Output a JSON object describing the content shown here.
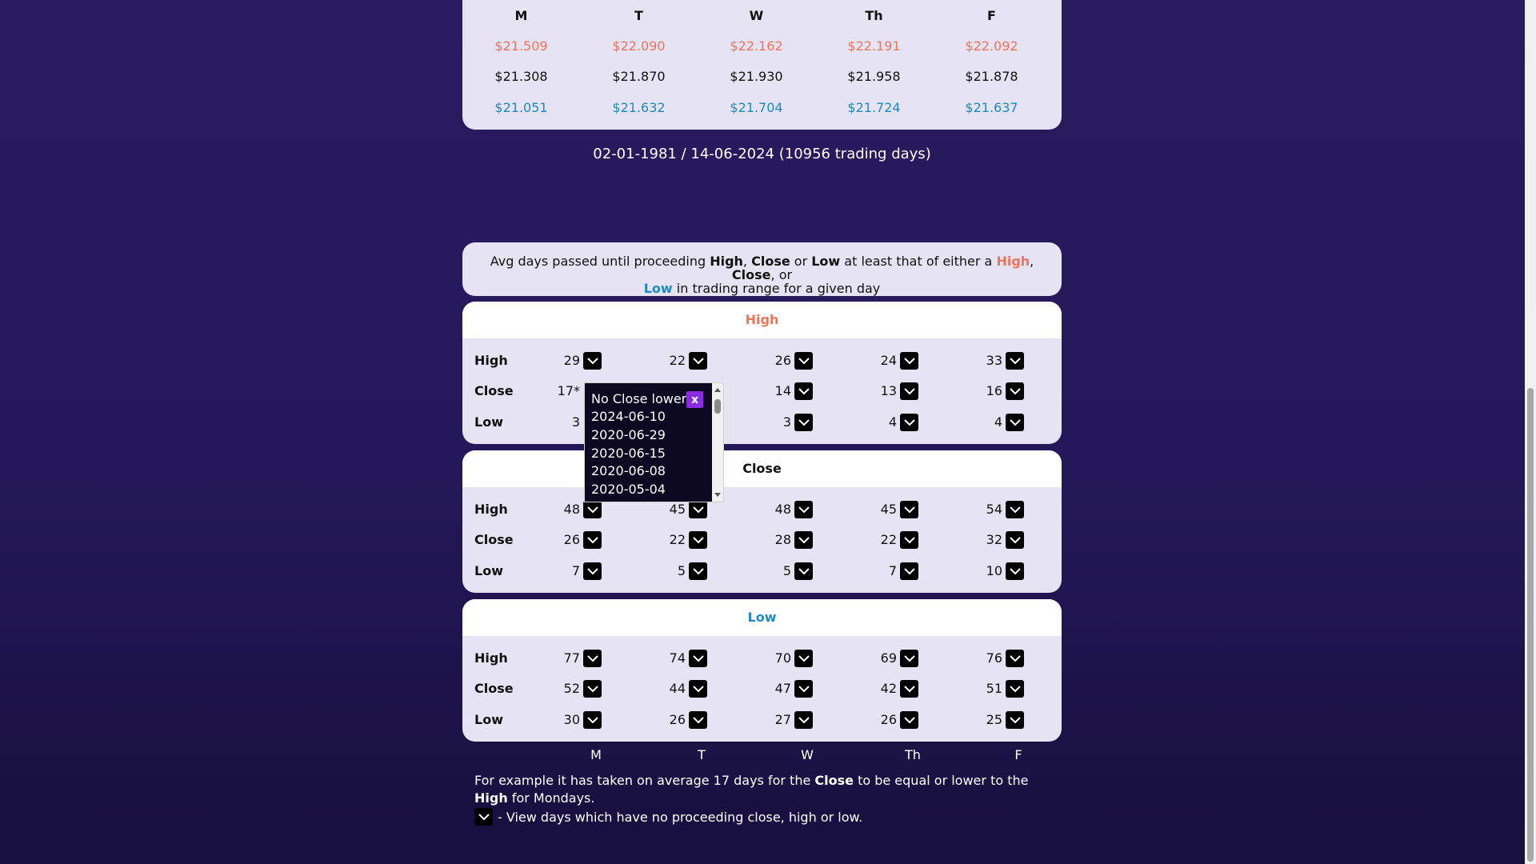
{
  "top_table": {
    "days": [
      "M",
      "T",
      "W",
      "Th",
      "F"
    ],
    "high": [
      "$21.509",
      "$22.090",
      "$22.162",
      "$22.191",
      "$22.092"
    ],
    "close": [
      "$21.308",
      "$21.870",
      "$21.930",
      "$21.958",
      "$21.878"
    ],
    "low": [
      "$21.051",
      "$21.632",
      "$21.704",
      "$21.724",
      "$21.637"
    ]
  },
  "range_text": "02-01-1981 / 14-06-2024 (10956 trading days)",
  "info": {
    "part1": "Avg days passed until proceeding ",
    "high": "High",
    "sep1": ", ",
    "close": "Close",
    "or1": " or ",
    "low": "Low",
    "part2": " at least that of either a ",
    "high2": "High",
    "sep2": ", ",
    "close2": "Close",
    "sep3": ", or",
    "low2": "Low",
    "part3": " in trading range for a given day"
  },
  "sections": [
    {
      "title": "High",
      "title_color": "#f4725a",
      "rows": [
        {
          "label": "High",
          "values": [
            "29",
            "22",
            "26",
            "24",
            "33"
          ]
        },
        {
          "label": "Close",
          "values": [
            "17*",
            "",
            "14",
            "13",
            "16"
          ]
        },
        {
          "label": "Low",
          "values": [
            "3",
            "",
            "3",
            "4",
            "4"
          ]
        }
      ]
    },
    {
      "title": "Close",
      "title_color": "#111111",
      "rows": [
        {
          "label": "High",
          "values": [
            "48",
            "45",
            "48",
            "45",
            "54"
          ]
        },
        {
          "label": "Close",
          "values": [
            "26",
            "22",
            "28",
            "22",
            "32"
          ]
        },
        {
          "label": "Low",
          "values": [
            "7",
            "5",
            "5",
            "7",
            "10"
          ]
        }
      ]
    },
    {
      "title": "Low",
      "title_color": "#1f8ac3",
      "rows": [
        {
          "label": "High",
          "values": [
            "77",
            "74",
            "70",
            "69",
            "76"
          ]
        },
        {
          "label": "Close",
          "values": [
            "52",
            "44",
            "47",
            "42",
            "51"
          ]
        },
        {
          "label": "Low",
          "values": [
            "30",
            "26",
            "27",
            "26",
            "25"
          ]
        }
      ]
    }
  ],
  "days_axis": [
    "M",
    "T",
    "W",
    "Th",
    "F"
  ],
  "footnote": {
    "part1": "For example it has taken on average 17 days for the ",
    "close": "Close",
    "part2": " to be equal or lower to the ",
    "high": "High",
    "part3": " for Mondays."
  },
  "legend_text": " - View days which have no proceeding close, high or low.",
  "popup": {
    "title": "No Close lower",
    "close_label": "x",
    "items": [
      "2024-06-10",
      "2020-06-29",
      "2020-06-15",
      "2020-06-08",
      "2020-05-04"
    ]
  },
  "colors": {
    "accent": "#8a2be2",
    "high": "#f4725a",
    "low": "#1f8ac3"
  },
  "icons": {
    "dropdown": "chevron-down-icon"
  }
}
